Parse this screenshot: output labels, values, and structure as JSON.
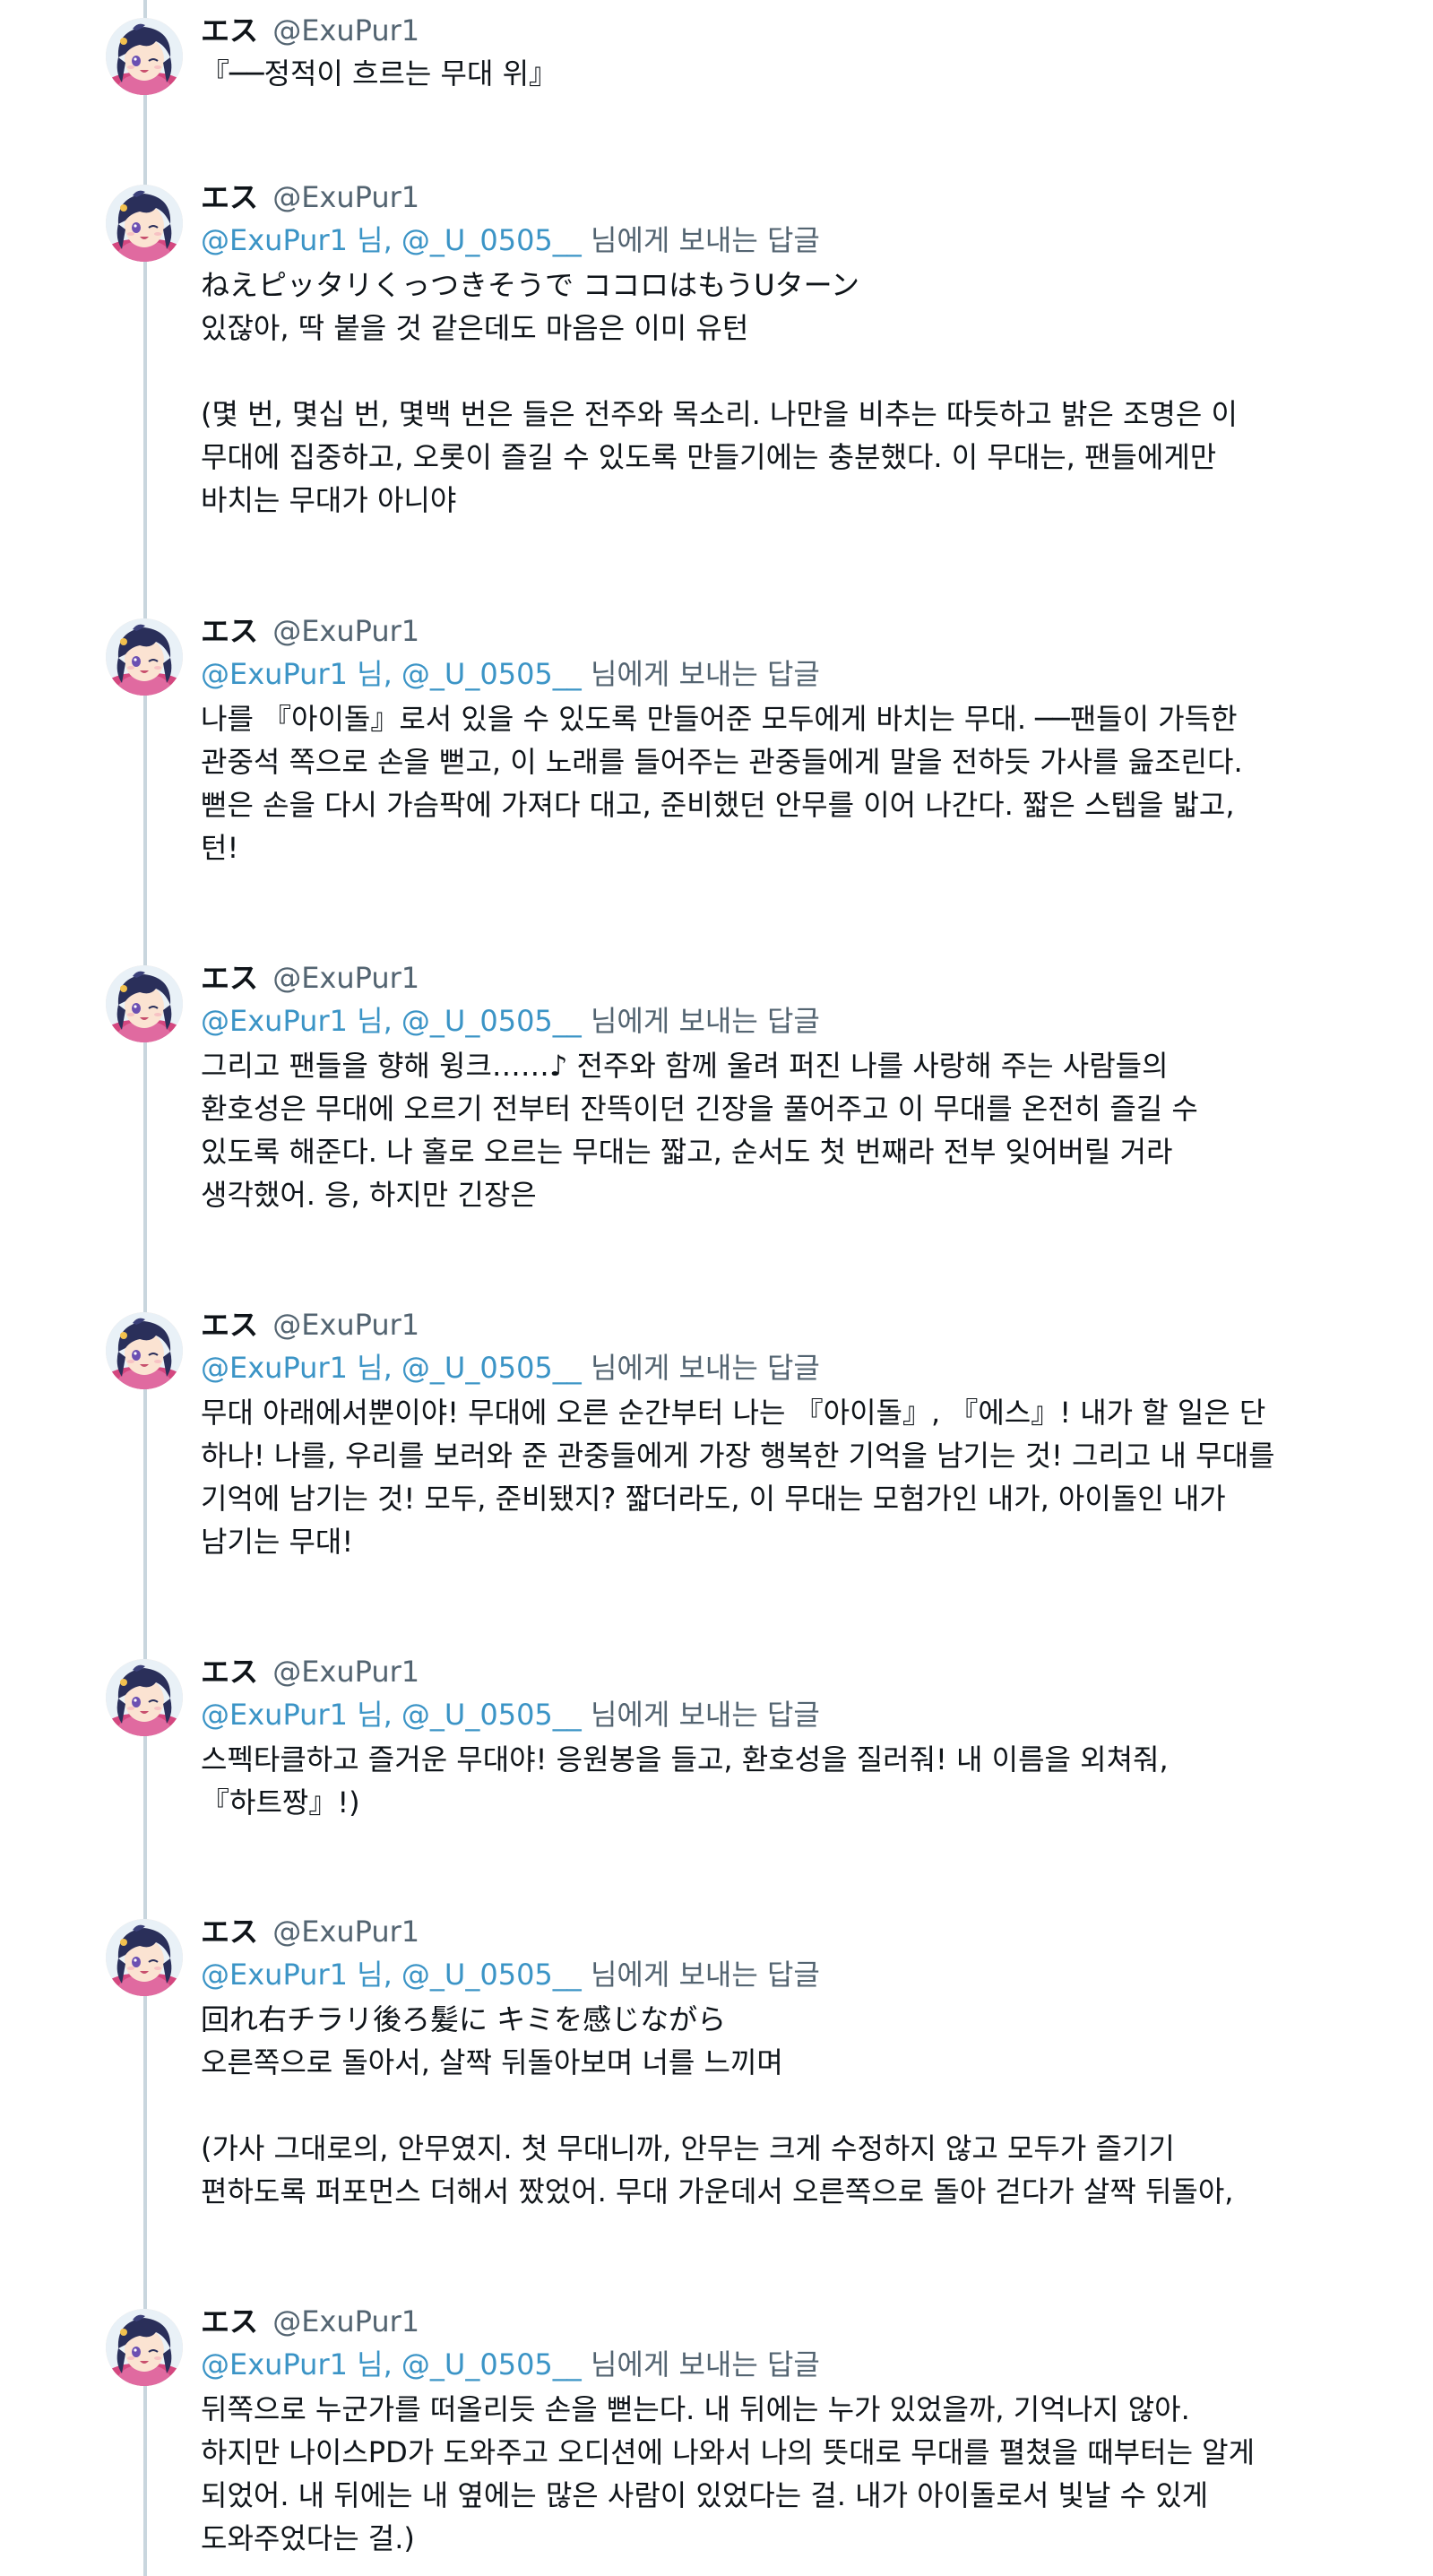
{
  "author": {
    "name": "エス",
    "handle": "@ExuPur1"
  },
  "reply_prefix": {
    "mentions": "@ExuPur1 님, @_U_0505__",
    "suffix": "님에게 보내는 답글"
  },
  "colors": {
    "mention": "#3b94c6",
    "handle": "#536471",
    "thread_line": "#c9d6de"
  },
  "avatar_icon": "anime-character-avatar",
  "tweets": [
    {
      "lines": [
        "『──정적이 흐르는 무대 위』"
      ]
    },
    {
      "lines": [
        "ねえピッタリくっつきそうで ココロはもうUターン",
        "있잖아, 딱 붙을 것 같은데도 마음은 이미 유턴",
        "",
        "(몇 번, 몇십 번, 몇백 번은 들은 전주와 목소리. 나만을 비추는 따듯하고 밝은 조명은 이",
        "무대에 집중하고, 오롯이 즐길 수 있도록 만들기에는 충분했다. 이 무대는, 팬들에게만",
        "바치는 무대가 아니야"
      ]
    },
    {
      "lines": [
        "나를 『아이돌』로서 있을 수 있도록 만들어준 모두에게 바치는 무대. ──팬들이 가득한",
        "관중석 쪽으로 손을 뻗고, 이 노래를 들어주는 관중들에게 말을 전하듯 가사를 읊조린다.",
        "뻗은 손을 다시 가슴팍에 가져다 대고, 준비했던 안무를 이어 나간다. 짧은 스텝을 밟고,",
        "턴!"
      ]
    },
    {
      "lines": [
        "그리고 팬들을 향해 윙크……♪ 전주와 함께 울려 퍼진 나를 사랑해 주는 사람들의",
        "환호성은 무대에 오르기 전부터 잔뜩이던 긴장을 풀어주고 이 무대를 온전히 즐길 수",
        "있도록 해준다. 나 홀로 오르는 무대는 짧고, 순서도 첫 번째라 전부 잊어버릴 거라",
        "생각했어. 응, 하지만 긴장은"
      ]
    },
    {
      "lines": [
        "무대 아래에서뿐이야! 무대에 오른 순간부터 나는 『아이돌』, 『에스』! 내가 할 일은 단",
        "하나! 나를, 우리를 보러와 준 관중들에게 가장 행복한 기억을 남기는 것! 그리고 내 무대를",
        "기억에 남기는 것! 모두, 준비됐지? 짧더라도, 이 무대는 모험가인 내가, 아이돌인 내가",
        "남기는 무대!"
      ]
    },
    {
      "lines": [
        "스펙타클하고 즐거운 무대야! 응원봉을 들고, 환호성을 질러줘! 내 이름을 외쳐줘,",
        "『하트짱』!)"
      ]
    },
    {
      "lines": [
        "回れ右チラリ後ろ髪に キミを感じながら",
        "오른쪽으로 돌아서, 살짝 뒤돌아보며 너를 느끼며",
        "",
        "(가사 그대로의, 안무였지. 첫 무대니까, 안무는 크게 수정하지 않고 모두가 즐기기",
        "편하도록 퍼포먼스 더해서 짰었어. 무대 가운데서 오른쪽으로 돌아 걷다가 살짝 뒤돌아,"
      ]
    },
    {
      "lines": [
        "뒤쪽으로 누군가를 떠올리듯 손을 뻗는다. 내 뒤에는 누가 있었을까, 기억나지 않아.",
        "하지만 나이스PD가 도와주고 오디션에 나와서 나의 뜻대로 무대를 펼쳤을 때부터는 알게",
        "되었어. 내 뒤에는 내 옆에는 많은 사람이 있었다는 걸. 내가 아이돌로서 빛날 수 있게",
        "도와주었다는 걸.)"
      ]
    }
  ]
}
